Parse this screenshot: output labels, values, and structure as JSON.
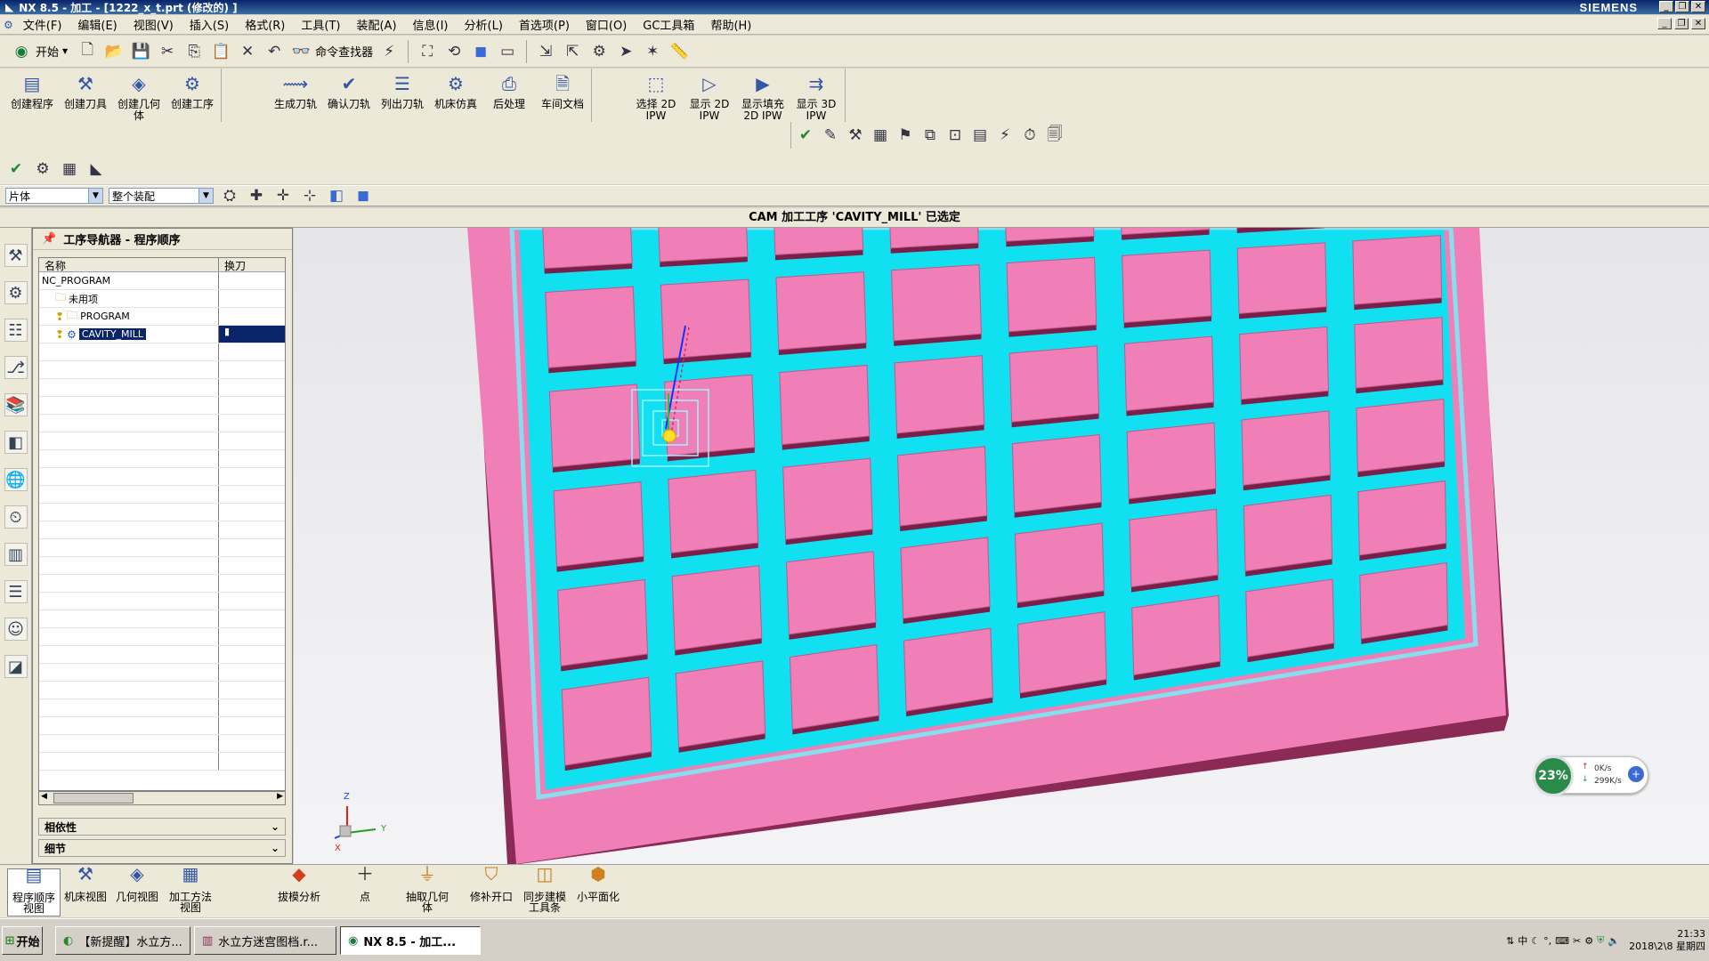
{
  "window": {
    "title": "NX 8.5 - 加工 - [1222_x_t.prt  (修改的) ]",
    "brand": "SIEMENS"
  },
  "menu": [
    "文件(F)",
    "编辑(E)",
    "视图(V)",
    "插入(S)",
    "格式(R)",
    "工具(T)",
    "装配(A)",
    "信息(I)",
    "分析(L)",
    "首选项(P)",
    "窗口(O)",
    "GC工具箱",
    "帮助(H)"
  ],
  "toolbar": {
    "start_label": "开始",
    "command_finder_label": "命令查找器"
  },
  "ribbon": {
    "group1": [
      {
        "label": "创建程序"
      },
      {
        "label": "创建刀具"
      },
      {
        "label": "创建几何\n体"
      },
      {
        "label": "创建工序"
      }
    ],
    "group2": [
      {
        "label": "生成刀轨"
      },
      {
        "label": "确认刀轨"
      },
      {
        "label": "列出刀轨"
      },
      {
        "label": "机床仿真"
      },
      {
        "label": "后处理"
      },
      {
        "label": "车间文档"
      }
    ],
    "group3": [
      {
        "label": "选择 2D\nIPW"
      },
      {
        "label": "显示 2D\nIPW"
      },
      {
        "label": "显示填充\n2D IPW"
      },
      {
        "label": "显示 3D\nIPW"
      }
    ]
  },
  "selection": {
    "type_filter": "片体",
    "scope": "整个装配"
  },
  "status": {
    "message": "CAM 加工工序 'CAVITY_MILL' 已选定"
  },
  "navigator": {
    "title": "工序导航器 - 程序顺序",
    "columns": [
      "名称",
      "换刀"
    ],
    "rows": [
      {
        "name": "NC_PROGRAM",
        "indent": 0,
        "icon": ""
      },
      {
        "name": "未用项",
        "indent": 1,
        "icon": "folder"
      },
      {
        "name": "PROGRAM",
        "indent": 1,
        "icon": "folder"
      },
      {
        "name": "CAVITY_MILL",
        "indent": 2,
        "icon": "op",
        "selected": true,
        "toolchange": "▮"
      }
    ],
    "panels": [
      "相依性",
      "细节"
    ]
  },
  "viewport": {
    "triad": {
      "x": "X",
      "y": "Y",
      "z": "Z"
    }
  },
  "network": {
    "percent": "23%",
    "up": "0K/s",
    "down": "299K/s"
  },
  "bottom_toolbar": [
    {
      "label": "程序顺序\n视图",
      "active": true
    },
    {
      "label": "机床视图"
    },
    {
      "label": "几何视图"
    },
    {
      "label": "加工方法\n视图"
    },
    {
      "label": "拔模分析"
    },
    {
      "label": "点"
    },
    {
      "label": "抽取几何\n体"
    },
    {
      "label": "修补开口"
    },
    {
      "label": "同步建模\n工具条"
    },
    {
      "label": "小平面化"
    }
  ],
  "taskbar": {
    "start": "开始",
    "tasks": [
      {
        "label": "【新提醒】水立方..."
      },
      {
        "label": "水立方迷宫图档.r..."
      },
      {
        "label": "NX 8.5 - 加工...",
        "active": true
      }
    ],
    "time": "21:33",
    "date": "2018\\2\\8 星期四"
  },
  "colors": {
    "part_pink": "#f07fb8",
    "toolpath_cyan": "#10e0f0",
    "selection_navy": "#0a246a"
  }
}
